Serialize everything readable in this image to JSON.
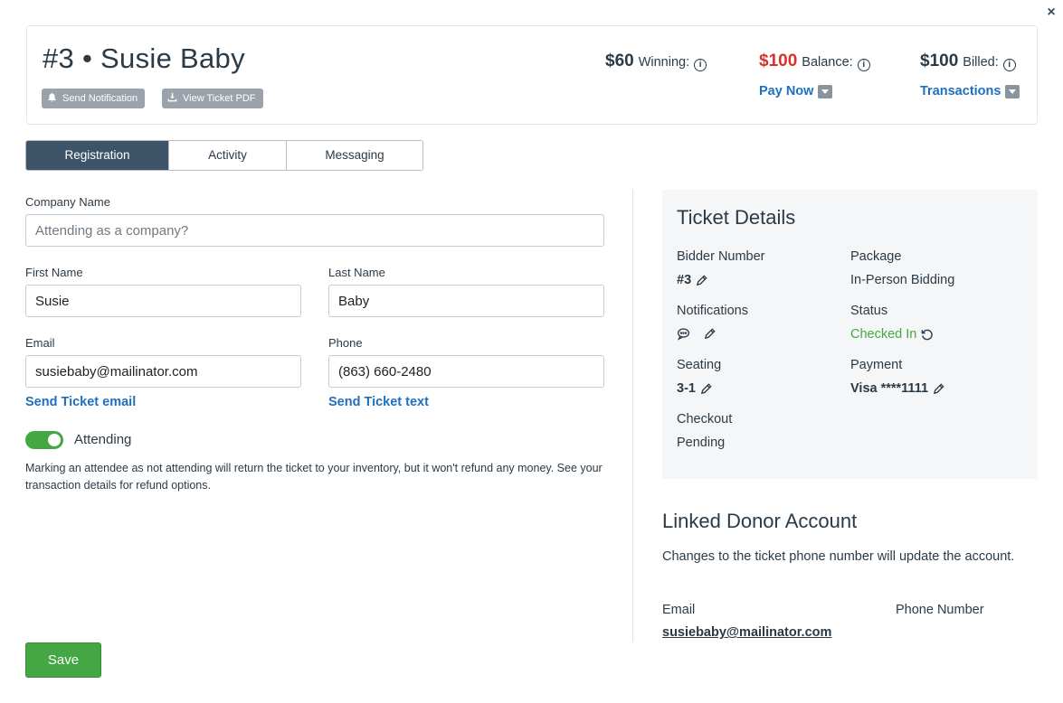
{
  "header": {
    "title": "#3 • Susie Baby",
    "send_notification": "Send Notification",
    "view_ticket_pdf": "View Ticket PDF",
    "winning_amount": "$60",
    "winning_label": "Winning:",
    "balance_amount": "$100",
    "balance_label": "Balance:",
    "billed_amount": "$100",
    "billed_label": "Billed:",
    "pay_now": "Pay Now",
    "transactions": "Transactions",
    "info_glyph": "i",
    "close_glyph": "×"
  },
  "tabs": [
    "Registration",
    "Activity",
    "Messaging"
  ],
  "form": {
    "company_label": "Company Name",
    "company_placeholder": "Attending as a company?",
    "company_value": "",
    "first_name_label": "First Name",
    "first_name_value": "Susie",
    "last_name_label": "Last Name",
    "last_name_value": "Baby",
    "email_label": "Email",
    "email_value": "susiebaby@mailinator.com",
    "phone_label": "Phone",
    "phone_value": "(863) 660-2480",
    "send_ticket_email": "Send Ticket email",
    "send_ticket_text": "Send Ticket text",
    "attending_label": "Attending",
    "attending_on": true,
    "attending_note": "Marking an attendee as not attending will return the ticket to your inventory, but it won't refund any money. See your transaction details for refund options.",
    "save": "Save"
  },
  "ticket_details": {
    "title": "Ticket Details",
    "bidder_number_label": "Bidder Number",
    "bidder_number_value": "#3",
    "package_label": "Package",
    "package_value": "In-Person Bidding",
    "notifications_label": "Notifications",
    "status_label": "Status",
    "status_value": "Checked In",
    "seating_label": "Seating",
    "seating_value": "3-1",
    "payment_label": "Payment",
    "payment_value": "Visa ****1111",
    "checkout_label": "Checkout",
    "checkout_value": "Pending"
  },
  "linked_donor": {
    "title": "Linked Donor Account",
    "description": "Changes to the ticket phone number will update the account.",
    "email_label": "Email",
    "phone_label": "Phone Number",
    "email_value": "susiebaby@mailinator.com"
  },
  "colors": {
    "accent_blue": "#1f6fbf",
    "balance_red": "#d6322b",
    "success_green": "#43a843",
    "active_tab": "#3d5468"
  }
}
